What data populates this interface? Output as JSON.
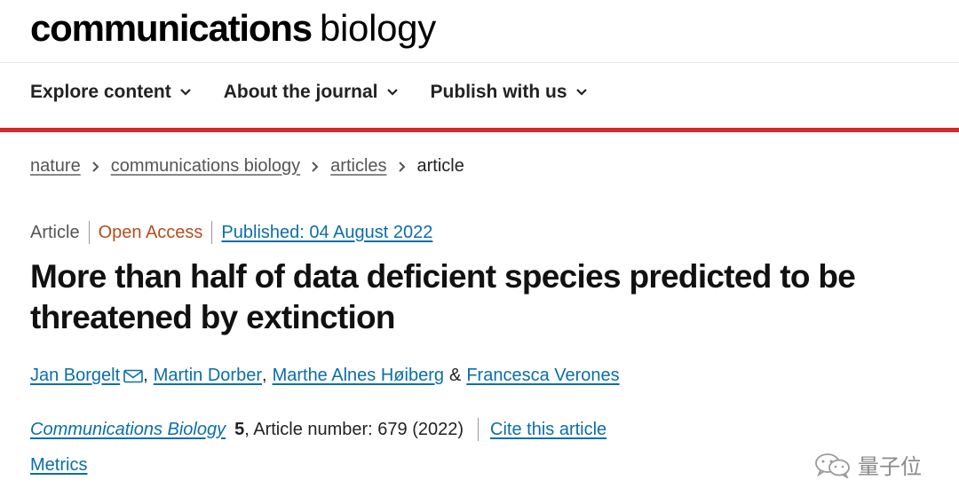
{
  "masthead": {
    "brand_bold": "communications",
    "brand_light": "biology"
  },
  "nav": {
    "items": [
      {
        "label": "Explore content"
      },
      {
        "label": "About the journal"
      },
      {
        "label": "Publish with us"
      }
    ]
  },
  "breadcrumb": {
    "items": [
      "nature",
      "communications biology",
      "articles"
    ],
    "current": "article"
  },
  "article": {
    "type": "Article",
    "access": "Open Access",
    "published": "Published: 04 August 2022",
    "title": "More than half of data deficient species predicted to be threatened by extinction",
    "authors": [
      "Jan Borgelt",
      "Martin Dorber",
      "Marthe Alnes Høiberg",
      "Francesca Verones"
    ],
    "author_separators": [
      ",",
      ",",
      "&"
    ],
    "journal": "Communications Biology",
    "volume": "5",
    "article_number": ", Article number: 679 (2022)",
    "cite_label": "Cite this article",
    "metrics_label": "Metrics"
  },
  "colors": {
    "accent_red": "#d42a2a",
    "link_blue": "#0b6ea8",
    "open_access_orange": "#b34e1d"
  },
  "icons": {
    "nav_chevron": "chevron-down-icon",
    "breadcrumb_sep": "chevron-right-icon",
    "author_contact": "mail-icon"
  },
  "watermark": {
    "text": "量子位"
  }
}
